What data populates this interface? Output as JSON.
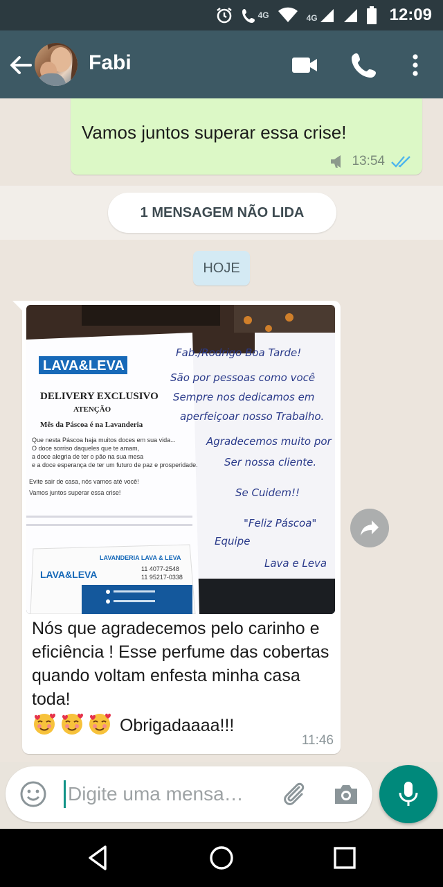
{
  "status_bar": {
    "time": "12:09",
    "network_tag_1": "4G",
    "network_tag_2": "4G",
    "icons": [
      "alarm-icon",
      "call-4g-icon",
      "wifi-icon",
      "signal-icon",
      "signal-icon",
      "battery-icon"
    ]
  },
  "header": {
    "contact_name": "Fabi",
    "icons": [
      "back-arrow-icon",
      "video-call-icon",
      "phone-call-icon",
      "more-vert-icon"
    ]
  },
  "messages": {
    "outgoing": {
      "text": "Vamos juntos superar essa crise!",
      "time": "13:54"
    },
    "unread_label": "1 MENSAGEM NÃO LIDA",
    "date_label": "HOJE",
    "incoming": {
      "photo": {
        "flyer_brand": "LAVA&LEVA",
        "flyer_title": "DELIVERY EXCLUSIVO",
        "flyer_subtitle": "ATENÇÃO",
        "flyer_heading": "Mês da Páscoa é na Lavanderia",
        "flyer_body": [
          "Que nesta Páscoa haja muitos doces em sua vida...",
          "O doce sorriso daqueles que te amam,",
          "a doce alegria de ter o pão na sua mesa",
          "e a doce esperança de ter um futuro de paz e prosperidade.",
          "Evite sair de casa, nós vamos até você!",
          "Vamos juntos superar essa crise!"
        ],
        "card_name": "LAVANDERIA LAVA & LEVA",
        "card_phone_1": "11 4077-2548",
        "card_phone_2": "11 95217-0338",
        "handwritten_note": [
          "Fab./Rodrigo   Boa Tarde!",
          "São por pessoas como você",
          "Sempre nos dedicamos em",
          "aperfeiçoar nosso Trabalho.",
          "Agradecemos muito por",
          "Ser nossa cliente.",
          "Se Cuidem!!",
          "\"Feliz Páscoa\"",
          "Equipe",
          "Lava e Leva"
        ]
      },
      "caption": "Nós que agradecemos pelo carinho e eficiência ! Esse perfume das cobertas quando voltam enfesta minha  casa toda!",
      "caption_end": "Obrigadaaaa!!!",
      "emoji": "smiling-face-with-hearts",
      "time": "11:46"
    }
  },
  "input": {
    "placeholder": "Digite uma mensa…"
  },
  "colors": {
    "header": "#3d5964",
    "outgoing_bubble": "#dcf8c6",
    "accent": "#00897b"
  }
}
